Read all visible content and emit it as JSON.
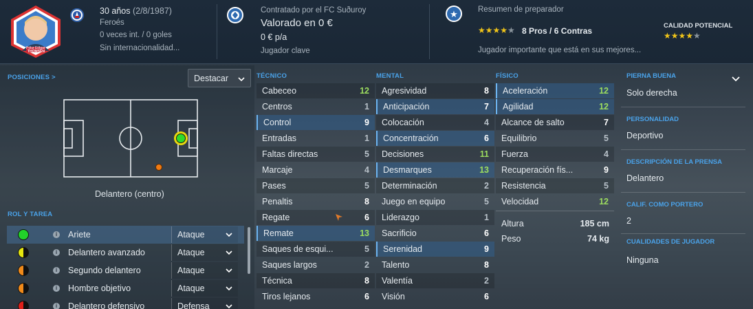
{
  "header": {
    "player_age": "30 años",
    "player_birth": "(2/8/1987)",
    "nationality": "Feroés",
    "intl": "0 veces int. / 0 goles",
    "intl_status": "Sin internacionalidad...",
    "card_name_line1": "Pólur Eiðgar",
    "card_name_line2": "THOMSEN",
    "contract_label": "Contratado por el FC Suðuroy",
    "value": "Valorado en 0 €",
    "wage": "0 € p/a",
    "squad_status": "Jugador clave",
    "coach_label": "Resumen de preparador",
    "coach_stars": "★★★★",
    "coach_half": "★",
    "pros_contras": "8 Pros / 6 Contras",
    "coach_summary": "Jugador importante que está en sus mejores...",
    "potential_label": "CALIDAD POTENCIAL",
    "potential_stars": "★★★★",
    "potential_half": "★"
  },
  "positions": {
    "heading": "POSICIONES",
    "chev": ">",
    "highlight_label": "Destacar",
    "position_name": "Delantero (centro)"
  },
  "roles": {
    "heading": "ROL Y TAREA",
    "items": [
      {
        "name": "Ariete",
        "duty": "Ataque"
      },
      {
        "name": "Delantero avanzado",
        "duty": "Ataque"
      },
      {
        "name": "Segundo delantero",
        "duty": "Ataque"
      },
      {
        "name": "Hombre objetivo",
        "duty": "Ataque"
      },
      {
        "name": "Delantero defensivo",
        "duty": "Defensa"
      }
    ]
  },
  "tecnico": {
    "heading": "TÉCNICO",
    "attrs": [
      {
        "name": "Cabeceo",
        "value": "12"
      },
      {
        "name": "Centros",
        "value": "1"
      },
      {
        "name": "Control",
        "value": "9"
      },
      {
        "name": "Entradas",
        "value": "1"
      },
      {
        "name": "Faltas directas",
        "value": "5"
      },
      {
        "name": "Marcaje",
        "value": "4"
      },
      {
        "name": "Pases",
        "value": "5"
      },
      {
        "name": "Penaltis",
        "value": "8"
      },
      {
        "name": "Regate",
        "value": "6"
      },
      {
        "name": "Remate",
        "value": "13"
      },
      {
        "name": "Saques de esqui...",
        "value": "5"
      },
      {
        "name": "Saques largos",
        "value": "2"
      },
      {
        "name": "Técnica",
        "value": "8"
      },
      {
        "name": "Tiros lejanos",
        "value": "6"
      }
    ]
  },
  "mental": {
    "heading": "MENTAL",
    "attrs": [
      {
        "name": "Agresividad",
        "value": "8"
      },
      {
        "name": "Anticipación",
        "value": "7"
      },
      {
        "name": "Colocación",
        "value": "4"
      },
      {
        "name": "Concentración",
        "value": "6"
      },
      {
        "name": "Decisiones",
        "value": "11"
      },
      {
        "name": "Desmarques",
        "value": "13"
      },
      {
        "name": "Determinación",
        "value": "2"
      },
      {
        "name": "Juego en equipo",
        "value": "5"
      },
      {
        "name": "Liderazgo",
        "value": "1"
      },
      {
        "name": "Sacrificio",
        "value": "6"
      },
      {
        "name": "Serenidad",
        "value": "9"
      },
      {
        "name": "Talento",
        "value": "8"
      },
      {
        "name": "Valentía",
        "value": "2"
      },
      {
        "name": "Visión",
        "value": "6"
      }
    ]
  },
  "fisico": {
    "heading": "FÍSICO",
    "attrs": [
      {
        "name": "Aceleración",
        "value": "12"
      },
      {
        "name": "Agilidad",
        "value": "12"
      },
      {
        "name": "Alcance de salto",
        "value": "7"
      },
      {
        "name": "Equilibrio",
        "value": "5"
      },
      {
        "name": "Fuerza",
        "value": "4"
      },
      {
        "name": "Recuperación fís...",
        "value": "9"
      },
      {
        "name": "Resistencia",
        "value": "5"
      },
      {
        "name": "Velocidad",
        "value": "12"
      }
    ],
    "height_label": "Altura",
    "height_value": "185 cm",
    "weight_label": "Peso",
    "weight_value": "74 kg"
  },
  "right": {
    "foot_label": "PIERNA BUENA",
    "foot_value": "Solo derecha",
    "personality_label": "PERSONALIDAD",
    "personality_value": "Deportivo",
    "press_label": "DESCRIPCIÓN DE LA PRENSA",
    "press_value": "Delantero",
    "gk_label": "CALIF. COMO PORTERO",
    "gk_value": "2",
    "qualities_label": "CUALIDADES DE JUGADOR",
    "qualities_value": "Ninguna"
  },
  "colors": {
    "accent": "#4aa3ea",
    "high_attr": "#9ddd5f",
    "header_bg": "#1d2b3a",
    "role_green": "#22d12a",
    "role_yellow": "#e5e50f",
    "role_orange": "#f08a1a"
  }
}
